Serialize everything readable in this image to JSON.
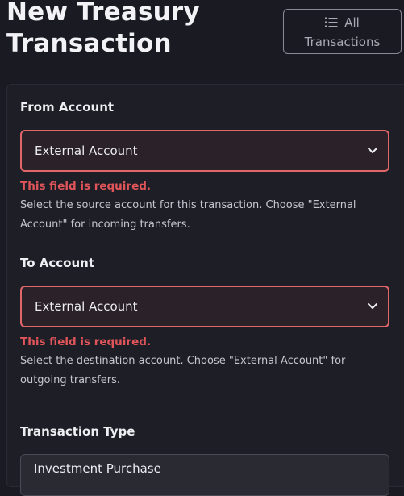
{
  "header": {
    "title": "New Treasury Transaction",
    "all_transactions_button": {
      "line1": "All",
      "line2": "Transactions"
    }
  },
  "form": {
    "from_account": {
      "label": "From Account",
      "selected": "External Account",
      "error": "This field is required.",
      "help": "Select the source account for this transaction. Choose \"External Account\" for incoming transfers."
    },
    "to_account": {
      "label": "To Account",
      "selected": "External Account",
      "error": "This field is required.",
      "help": "Select the destination account. Choose \"External Account\" for outgoing transfers."
    },
    "transaction_type": {
      "label": "Transaction Type",
      "selected": "Investment Purchase"
    }
  },
  "icons": {
    "all_transactions": "list-icon",
    "select_arrow": "chevron-down-icon"
  },
  "colors": {
    "background": "#1a1a22",
    "error": "#e0555a",
    "error_border": "#e0666a"
  }
}
